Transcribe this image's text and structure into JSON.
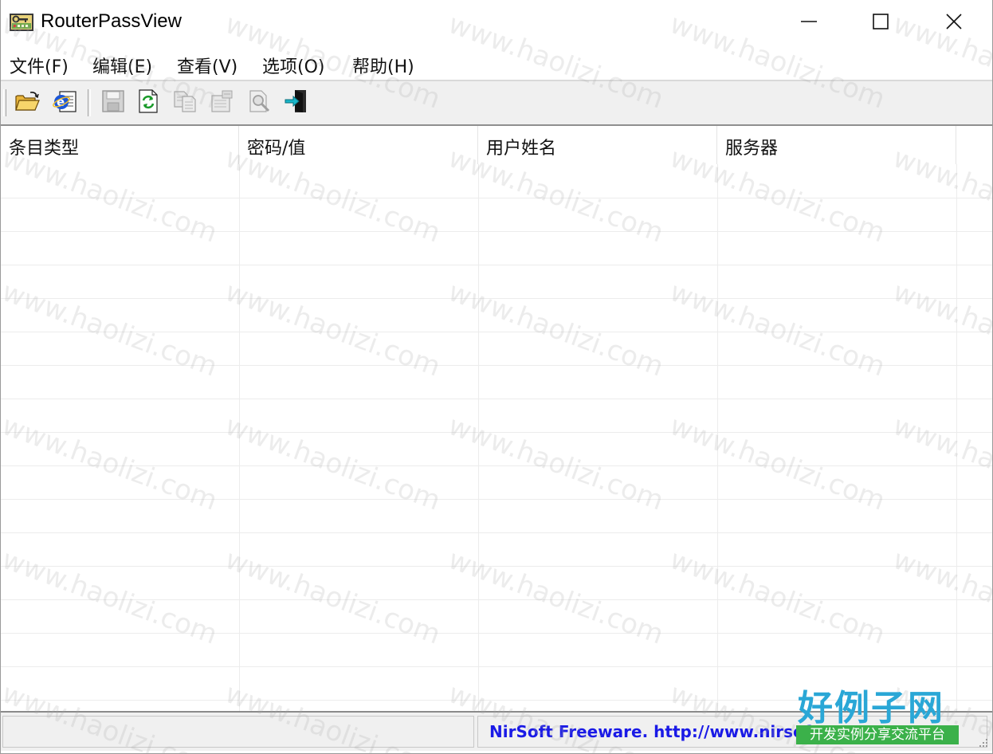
{
  "window": {
    "title": "RouterPassView"
  },
  "titlebar_buttons": {
    "minimize_icon": "minimize-icon",
    "maximize_icon": "maximize-icon",
    "close_icon": "close-icon"
  },
  "menu": {
    "items": [
      {
        "label": "文件(F)"
      },
      {
        "label": "编辑(E)"
      },
      {
        "label": "查看(V)"
      },
      {
        "label": "选项(O)"
      },
      {
        "label": "帮助(H)"
      }
    ]
  },
  "toolbar": {
    "buttons": [
      {
        "icon": "open-folder-icon",
        "enabled": true
      },
      {
        "icon": "internet-explorer-icon",
        "enabled": true
      },
      {
        "icon": "save-icon",
        "enabled": false
      },
      {
        "icon": "refresh-icon",
        "enabled": true
      },
      {
        "icon": "copy-icon",
        "enabled": false
      },
      {
        "icon": "properties-icon",
        "enabled": false
      },
      {
        "icon": "find-icon",
        "enabled": false
      },
      {
        "icon": "exit-icon",
        "enabled": true
      }
    ]
  },
  "list": {
    "columns": [
      {
        "label": "条目类型"
      },
      {
        "label": "密码/值"
      },
      {
        "label": "用户姓名"
      },
      {
        "label": "服务器"
      }
    ],
    "rows": []
  },
  "statusbar": {
    "left_text": "",
    "link_text": "NirSoft Freeware.  http://www.nirsoft.net"
  },
  "watermark": {
    "text": "www.haolizi.com",
    "logo_title": "好例子网",
    "logo_subtitle": "开发实例分享交流平台"
  },
  "colors": {
    "link": "#1a1ae6",
    "logo_blue": "#2aa7d6",
    "logo_green": "#3bb14a",
    "toolbar_bg": "#f0f0f0"
  }
}
